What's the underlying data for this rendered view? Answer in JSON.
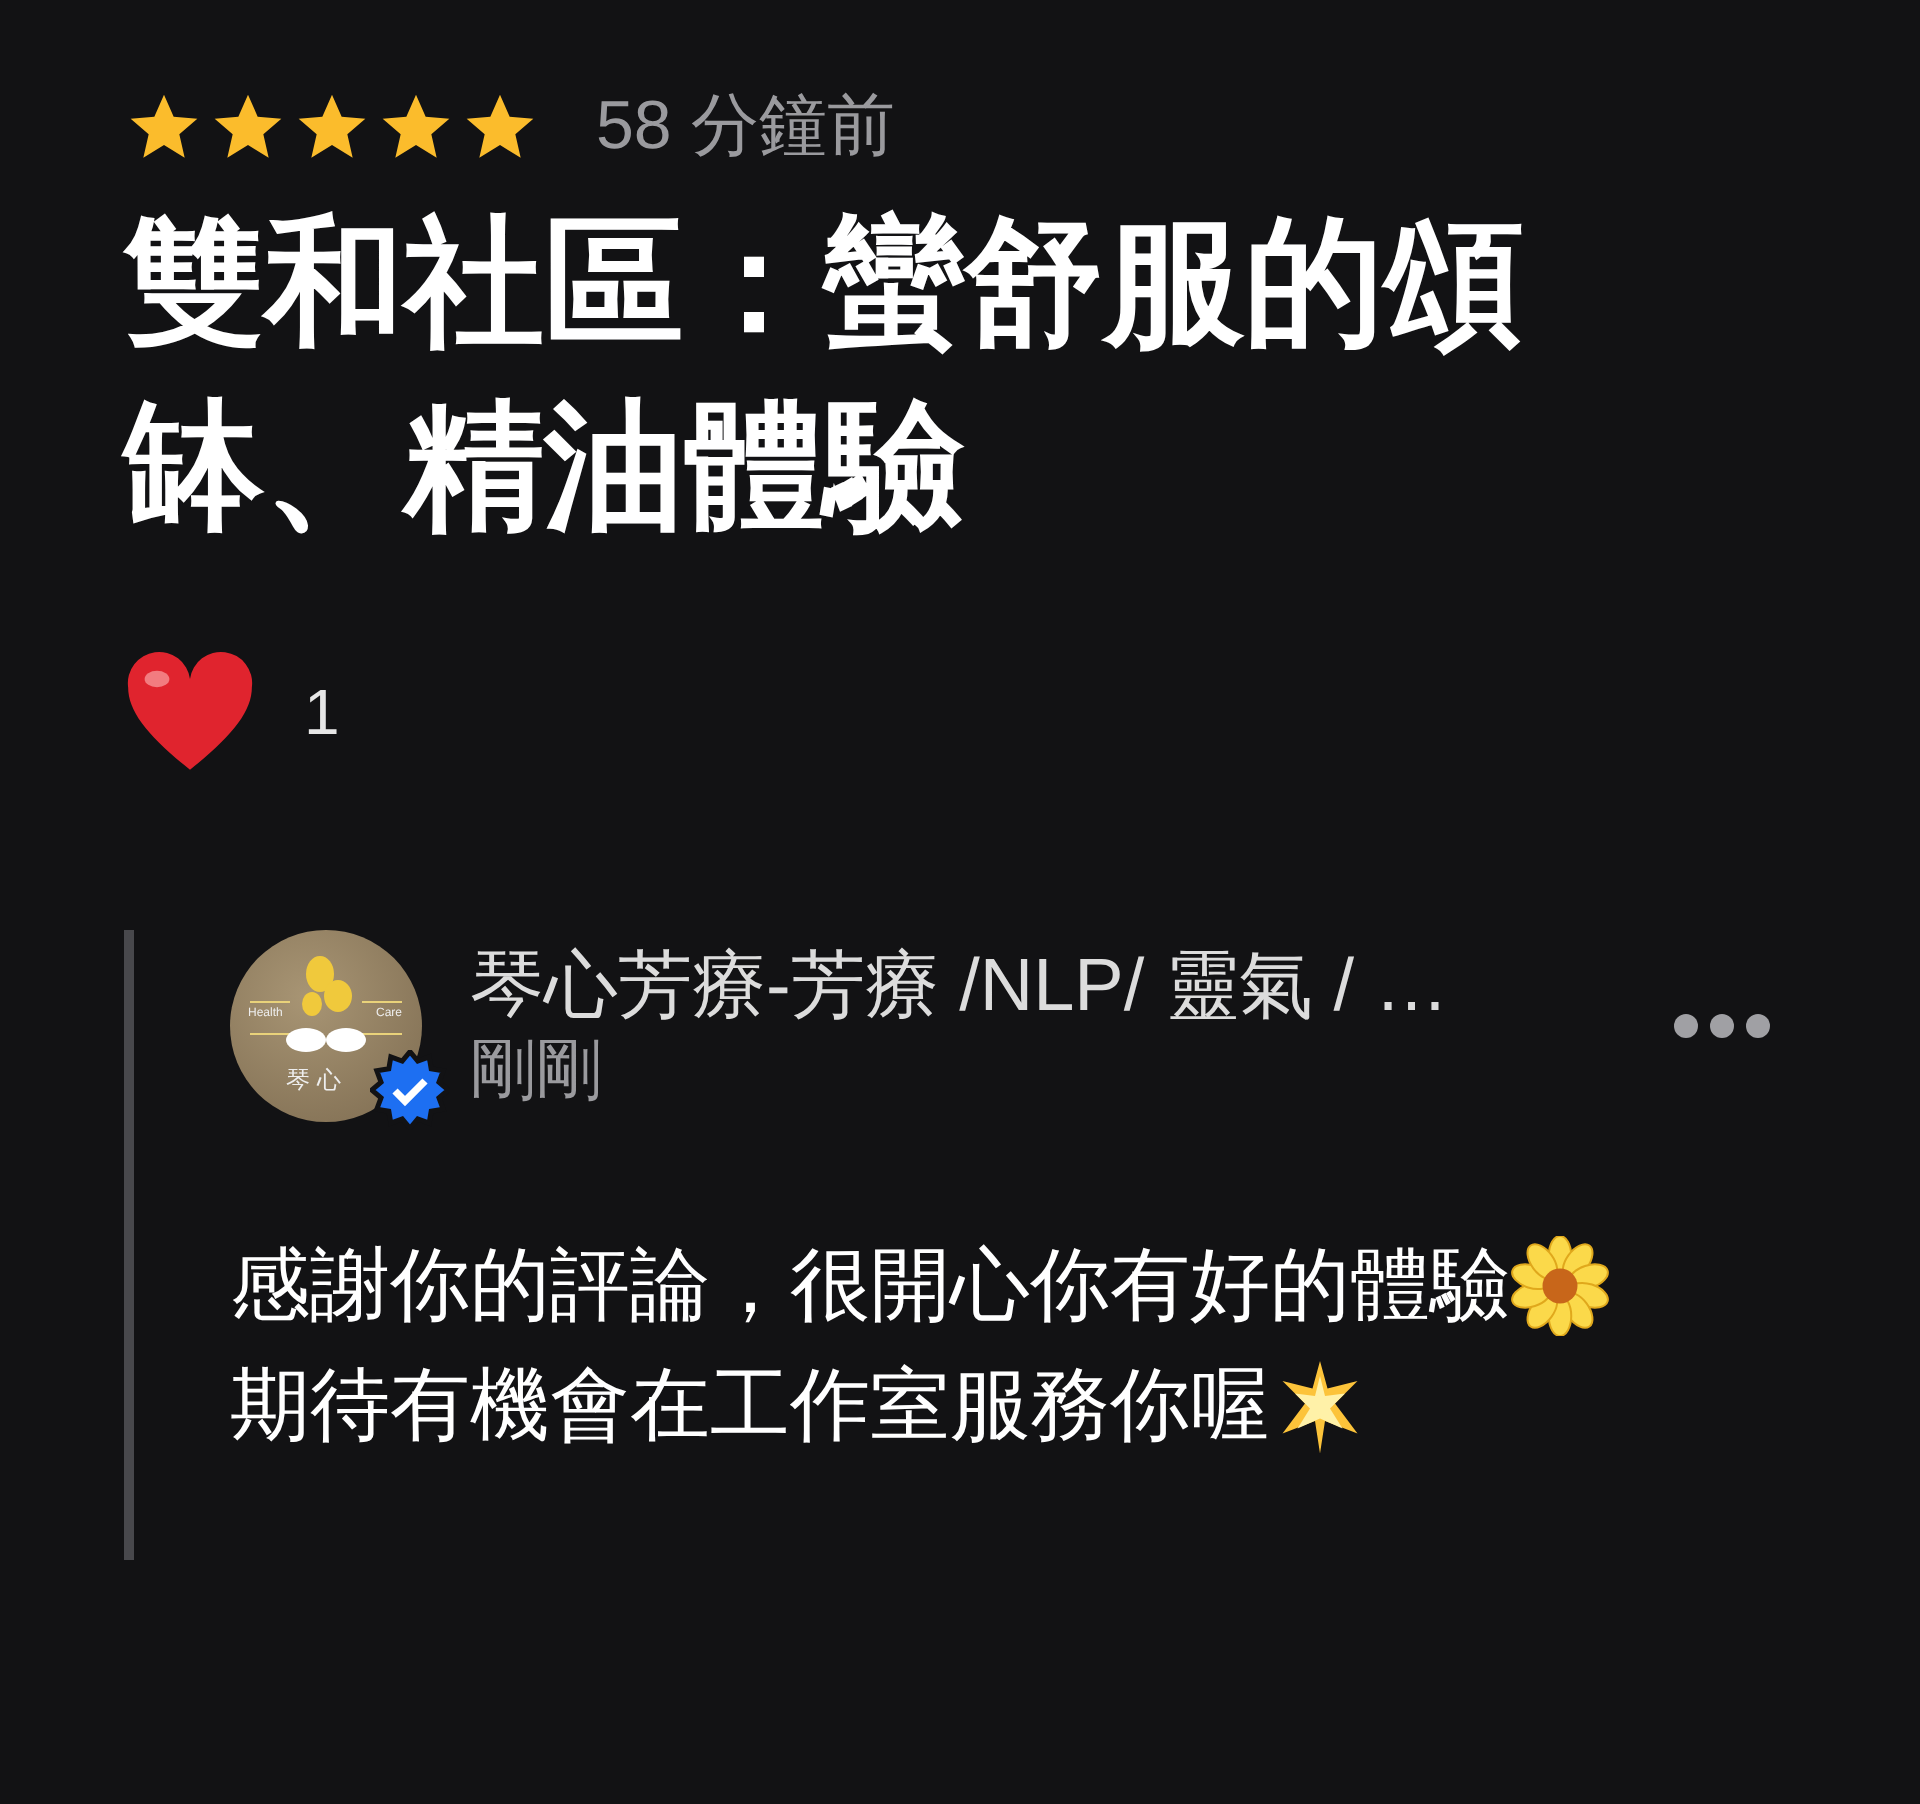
{
  "review": {
    "stars": 5,
    "time": "58 分鐘前",
    "title": "雙和社區：蠻舒服的頌缽、精油體驗",
    "likes": "1"
  },
  "reply": {
    "avatar": {
      "logo_text": "琴 心",
      "left_text": "Health",
      "right_text": "Care",
      "verified": true
    },
    "author": "琴心芳療-芳療 /NLP/ 靈氣 / …",
    "time": "剛剛",
    "lines": [
      "感謝你的評論，很開心你有好的體驗",
      "期待有機會在工作室服務你喔"
    ]
  }
}
